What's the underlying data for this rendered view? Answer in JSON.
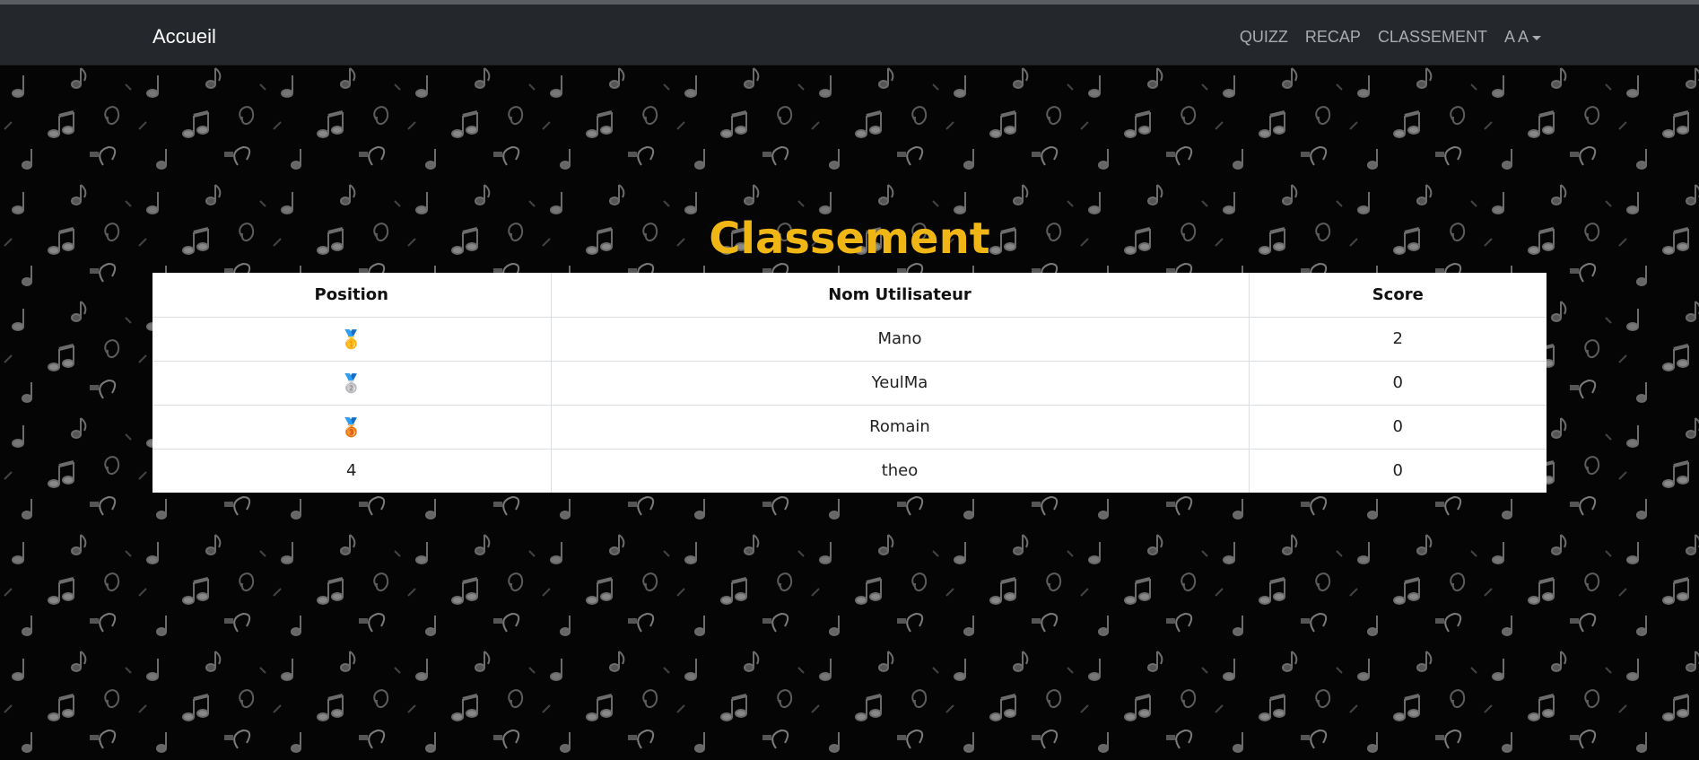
{
  "navbar": {
    "brand": "Accueil",
    "links": [
      "QUIZZ",
      "RECAP",
      "CLASSEMENT"
    ],
    "user_label": "A A"
  },
  "page": {
    "title": "Classement"
  },
  "table": {
    "headers": [
      "Position",
      "Nom Utilisateur",
      "Score"
    ],
    "rows": [
      {
        "position": "🥇",
        "name": "Mano",
        "score": "2"
      },
      {
        "position": "🥈",
        "name": "YeulMa",
        "score": "0"
      },
      {
        "position": "🥉",
        "name": "Romain",
        "score": "0"
      },
      {
        "position": "4",
        "name": "theo",
        "score": "0"
      }
    ]
  },
  "colors": {
    "title": "#f0b615",
    "navbar_bg": "#24272b",
    "page_bg": "#050505"
  }
}
